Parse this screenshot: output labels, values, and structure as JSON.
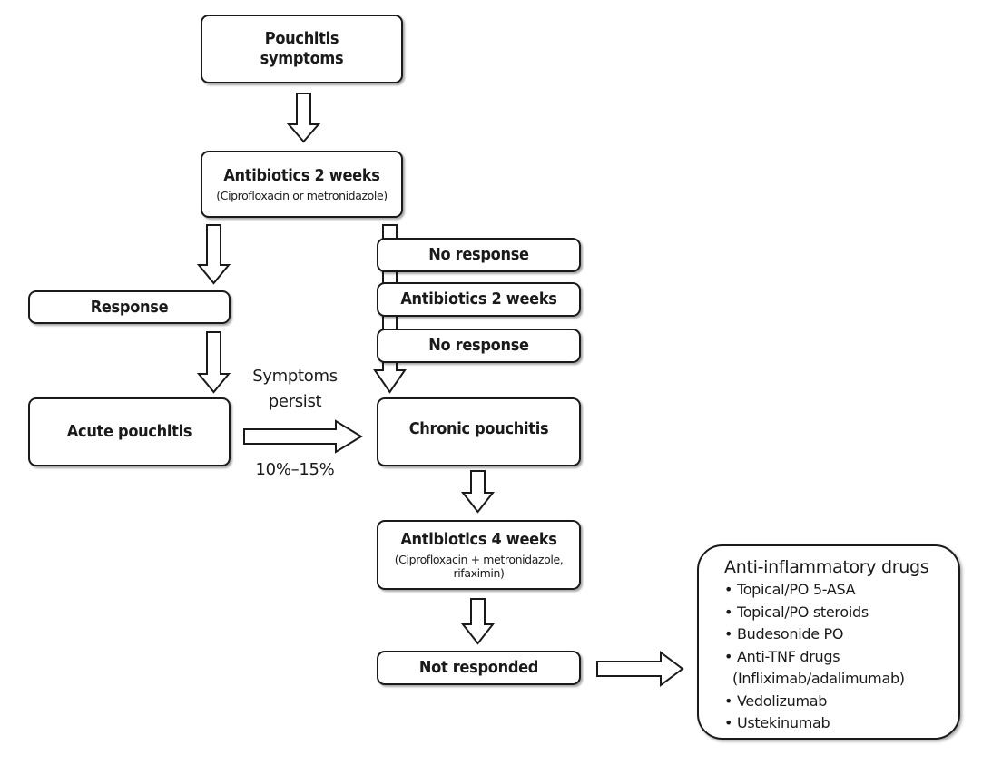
{
  "nodes": {
    "symptoms": {
      "line1": "Pouchitis",
      "line2": "symptoms"
    },
    "antibiotics_2w": {
      "title": "Antibiotics 2 weeks",
      "sub": "(Ciprofloxacin or metronidazole)"
    },
    "response": "Response",
    "acute": "Acute pouchitis",
    "no_response_1": "No response",
    "antibiotics_2w_b": "Antibiotics 2 weeks",
    "no_response_2": "No response",
    "chronic": "Chronic pouchitis",
    "antibiotics_4w": {
      "title": "Antibiotics 4 weeks",
      "sub1": "(Ciprofloxacin + metronidazole,",
      "sub2": "rifaximin)"
    },
    "not_responded": "Not responded",
    "anti_inflammatory": {
      "title": "Anti-inflammatory drugs",
      "items": [
        "Topical/PO 5-ASA",
        "Topical/PO steroids",
        "Budesonide PO",
        "Anti-TNF drugs",
        "(Infliximab/adalimumab)",
        "Vedolizumab",
        "Ustekinumab"
      ]
    }
  },
  "labels": {
    "symptoms_persist_1": "Symptoms",
    "symptoms_persist_2": "persist",
    "rate": "10%–15%"
  }
}
